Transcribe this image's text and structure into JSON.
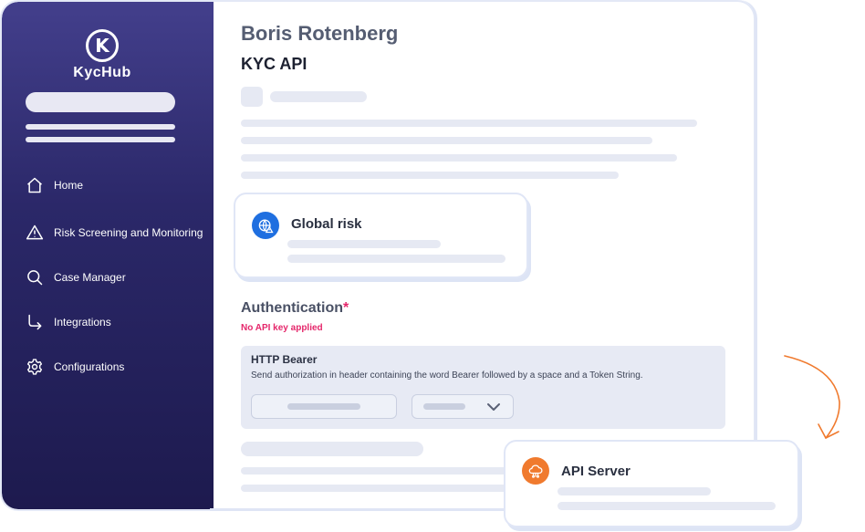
{
  "brand": {
    "logo_letter": "K",
    "name": "KycHub"
  },
  "sidebar": {
    "items": [
      {
        "label": "Home",
        "icon": "home-icon"
      },
      {
        "label": "Risk Screening and Monitoring",
        "icon": "warning-icon"
      },
      {
        "label": "Case Manager",
        "icon": "search-icon"
      },
      {
        "label": "Integrations",
        "icon": "arrow-down-right-icon"
      },
      {
        "label": "Configurations",
        "icon": "gear-icon"
      }
    ]
  },
  "header": {
    "user_name": "Boris Rotenberg",
    "page_title": "KYC API"
  },
  "global_risk": {
    "title": "Global risk",
    "icon": "globe-warning-icon",
    "icon_color": "#1f6fe0"
  },
  "auth": {
    "title": "Authentication",
    "required_mark": "*",
    "warning": "No API key applied",
    "method_title": "HTTP Bearer",
    "method_desc": "Send authorization in header containing the word Bearer followed by a space and a Token String."
  },
  "api_server": {
    "title": "API Server",
    "icon": "cloud-server-icon",
    "icon_color": "#f07a2e"
  },
  "colors": {
    "accent": "#e5276b",
    "sidebar_top": "#433f8c",
    "sidebar_bottom": "#1d1a4e",
    "arrow": "#f07a2e"
  }
}
